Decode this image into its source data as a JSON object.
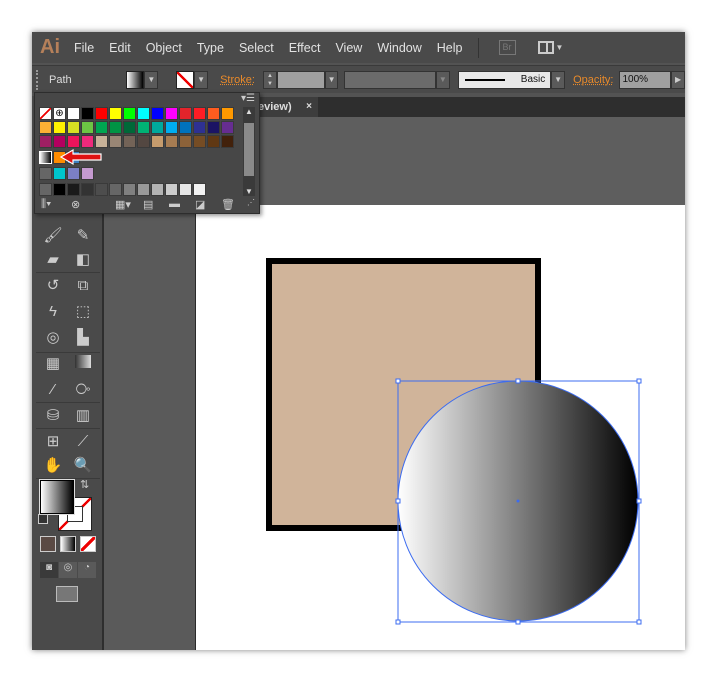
{
  "app": {
    "logo": "Ai"
  },
  "menu": [
    "File",
    "Edit",
    "Object",
    "Type",
    "Select",
    "Effect",
    "View",
    "Window",
    "Help"
  ],
  "bridge_label": "Br",
  "control": {
    "selection_type": "Path",
    "stroke_label": "Stroke:",
    "brush_label": "Basic",
    "opacity_label": "Opacity:",
    "opacity_value": "100%"
  },
  "document_tab": {
    "title": "eview)",
    "close": "×"
  },
  "swatches": {
    "rows": [
      [
        "none",
        "registration",
        "#ffffff",
        "#000000",
        "#ff0000",
        "#ffff00",
        "#00ff00",
        "#00ffff",
        "#0000ff",
        "#ff00ff",
        "#e3242b",
        "#ff1d25",
        "#ff5c1f",
        "#ff9900"
      ],
      [
        "#fbb034",
        "#fff200",
        "#d7df23",
        "#6cc644",
        "#00a651",
        "#009444",
        "#006838",
        "#00b274",
        "#00a99d",
        "#00aeef",
        "#0072bc",
        "#2e3192",
        "#1b1464",
        "#662d91"
      ],
      [
        "#9e1f63",
        "#b3005f",
        "#ed145b",
        "#ee2a7b",
        "#c7b299",
        "#998675",
        "#736357",
        "#534741",
        "#c69c6d",
        "#a67c52",
        "#8c6239",
        "#754c24",
        "#603813",
        "#42210b"
      ]
    ],
    "group1": [
      "gradient",
      "#ff8c00",
      "#3a7fc0"
    ],
    "group2": [
      "#00c5cd",
      "#7b7fc4",
      "#c59ad0"
    ],
    "grays": [
      "#000000",
      "#1a1a1a",
      "#333333",
      "#4d4d4d",
      "#666666",
      "#808080",
      "#999999",
      "#b3b3b3",
      "#cccccc",
      "#e6e6e6",
      "#f2f2f2"
    ]
  },
  "colors": {
    "square_fill": "#d0b49a",
    "square_stroke": "#000000",
    "selection": "#3c6cf0",
    "annotation_arrow": "#e01010"
  }
}
